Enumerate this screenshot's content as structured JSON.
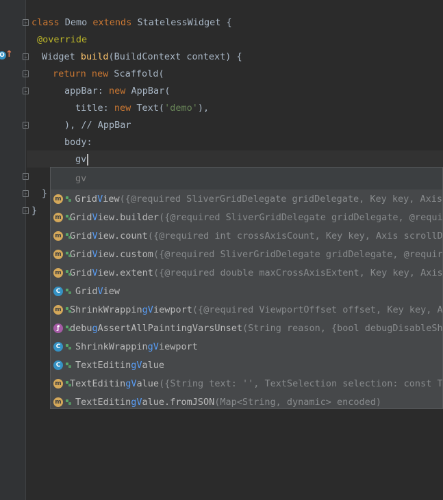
{
  "editor": {
    "lines": [
      {
        "t1": "class ",
        "t2": "Demo ",
        "t3": "extends ",
        "t4": "StatelessWidget {"
      },
      {
        "ann": "@override"
      },
      {
        "t1": "Widget ",
        "t2": "build",
        "t3": "(BuildContext context) {"
      },
      {
        "t1": "return ",
        "t2": "new ",
        "t3": "Scaffold("
      },
      {
        "t1": "appBar: ",
        "t2": "new ",
        "t3": "AppBar("
      },
      {
        "t1": "title: ",
        "t2": "new ",
        "t3": "Text(",
        "t4": "'demo'",
        "t5": "),"
      },
      {
        "t1": "), // AppBar"
      },
      {
        "t1": "body:"
      },
      {
        "t1": "gv"
      },
      {
        "t1": ""
      },
      {
        "t1": "}"
      },
      {
        "t1": "}"
      }
    ]
  },
  "autocomplete": {
    "typed": "gv",
    "items": [
      {
        "icon": "m",
        "name_pre": "Grid",
        "name_mid": "V",
        "name_post": "iew",
        "sig": "({@required SliverGridDelegate gridDelegate, Key key, Axis"
      },
      {
        "icon": "m",
        "name_pre": "Grid",
        "name_mid": "V",
        "name_post": "iew.builder",
        "sig": "({@required SliverGridDelegate gridDelegate, @requi"
      },
      {
        "icon": "m",
        "name_pre": "Grid",
        "name_mid": "V",
        "name_post": "iew.count",
        "sig": "({@required int crossAxisCount, Key key, Axis scrollD"
      },
      {
        "icon": "m",
        "name_pre": "Grid",
        "name_mid": "V",
        "name_post": "iew.custom",
        "sig": "({@required SliverGridDelegate gridDelegate, @requir"
      },
      {
        "icon": "m",
        "name_pre": "Grid",
        "name_mid": "V",
        "name_post": "iew.extent",
        "sig": "({@required double maxCrossAxisExtent, Key key, Axis"
      },
      {
        "icon": "c",
        "name_pre": "Grid",
        "name_mid": "V",
        "name_post": "iew",
        "sig": ""
      },
      {
        "icon": "m",
        "name_pre": "ShrinkWrappin",
        "name_mid": "gV",
        "name_post": "iewport",
        "sig": "({@required ViewportOffset offset, Key key, A"
      },
      {
        "icon": "f",
        "name_pre": "debu",
        "name_mid": "g",
        "name_post": "AssertAllPaintingVarsUnset",
        "sig": "(String reason, {bool debugDisableSh"
      },
      {
        "icon": "c",
        "name_pre": "ShrinkWrappin",
        "name_mid": "gV",
        "name_post": "iewport",
        "sig": ""
      },
      {
        "icon": "c",
        "name_pre": "TextEditin",
        "name_mid": "gV",
        "name_post": "alue",
        "sig": ""
      },
      {
        "icon": "m",
        "name_pre": "TextEditin",
        "name_mid": "gV",
        "name_post": "alue",
        "sig": "({String text: '', TextSelection selection: const T"
      },
      {
        "icon": "m",
        "name_pre": "TextEditin",
        "name_mid": "gV",
        "name_post": "alue.fromJSON",
        "sig": "(Map<String, dynamic> encoded)"
      }
    ]
  },
  "colors": {
    "background": "#2b2b2b",
    "keyword": "#cc7832",
    "annotation": "#bbb529",
    "string": "#6a8759",
    "function": "#ffc66d",
    "popup_bg": "#46484a",
    "match_highlight": "#589df6"
  }
}
